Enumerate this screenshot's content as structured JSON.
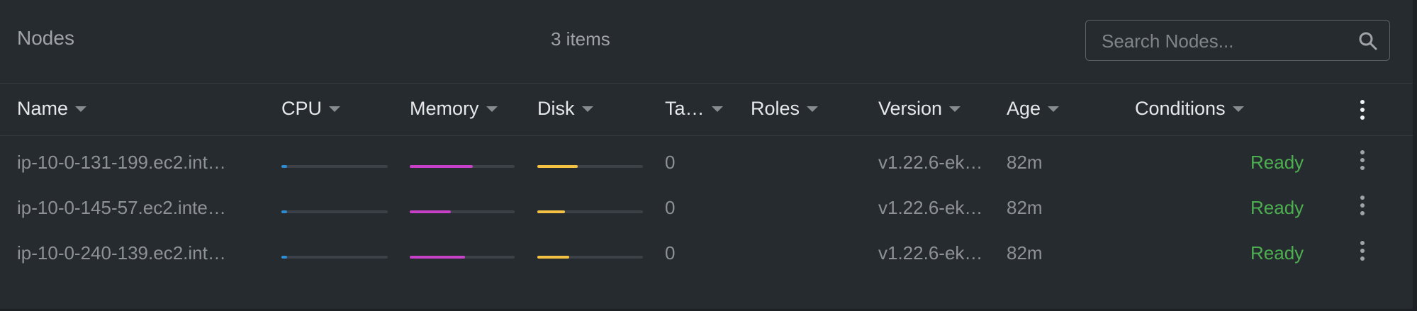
{
  "header": {
    "title": "Nodes",
    "count": "3 items",
    "search_placeholder": "Search Nodes..."
  },
  "columns": {
    "name": "Name",
    "cpu": "CPU",
    "memory": "Memory",
    "disk": "Disk",
    "taints": "Ta…",
    "roles": "Roles",
    "version": "Version",
    "age": "Age",
    "conditions": "Conditions"
  },
  "colors": {
    "cpu": "#2e8bd2",
    "memory": "#c640c8",
    "disk": "#f5c142",
    "ready": "#4caf50"
  },
  "icons": {
    "search": "search-icon",
    "row_menu": "kebab-menu-icon",
    "header_menu": "kebab-menu-icon"
  },
  "rows": [
    {
      "name": "ip-10-0-131-199.ec2.int…",
      "cpu": 0.05,
      "memory": 0.6,
      "disk": 0.38,
      "taints": "0",
      "roles": "",
      "version": "v1.22.6-ek…",
      "age": "82m",
      "condition": "Ready"
    },
    {
      "name": "ip-10-0-145-57.ec2.inte…",
      "cpu": 0.05,
      "memory": 0.39,
      "disk": 0.26,
      "taints": "0",
      "roles": "",
      "version": "v1.22.6-ek…",
      "age": "82m",
      "condition": "Ready"
    },
    {
      "name": "ip-10-0-240-139.ec2.int…",
      "cpu": 0.05,
      "memory": 0.53,
      "disk": 0.3,
      "taints": "0",
      "roles": "",
      "version": "v1.22.6-ek…",
      "age": "82m",
      "condition": "Ready"
    }
  ]
}
